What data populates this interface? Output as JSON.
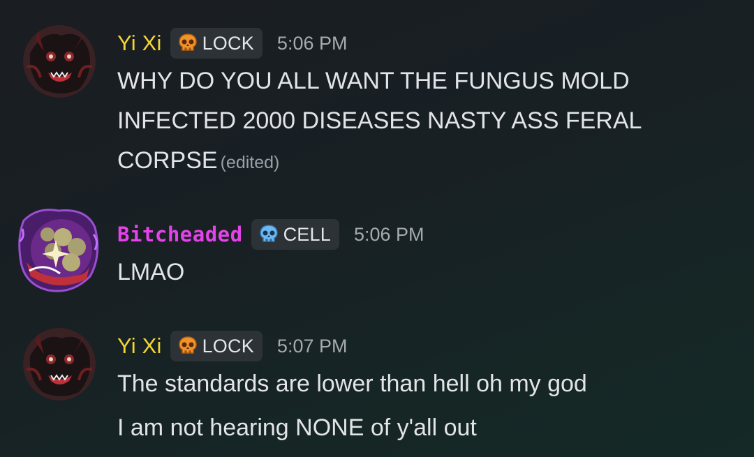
{
  "messages": [
    {
      "author": "Yi Xi",
      "tag": "LOCK",
      "tag_icon": "orange-skull-icon",
      "timestamp": "5:06 PM",
      "text": "WHY DO YOU ALL WANT THE FUNGUS MOLD INFECTED 2000 DISEASES NASTY ASS FERAL CORPSE",
      "edited": "(edited)"
    },
    {
      "author": "Bitcheaded",
      "tag": "CELL",
      "tag_icon": "blue-skull-icon",
      "timestamp": "5:06 PM",
      "text": "LMAO"
    },
    {
      "author": "Yi Xi",
      "tag": "LOCK",
      "tag_icon": "orange-skull-icon",
      "timestamp": "5:07 PM",
      "lines": [
        "The standards are lower than hell oh my god",
        "I am not hearing NONE of y'all out"
      ]
    }
  ],
  "colors": {
    "yi_xi_name": "#f5d532",
    "bitcheaded_name": "#e443e9",
    "tag_background": "#2c3236",
    "timestamp": "#a6abb2",
    "message_text": "#e2e4e8"
  }
}
